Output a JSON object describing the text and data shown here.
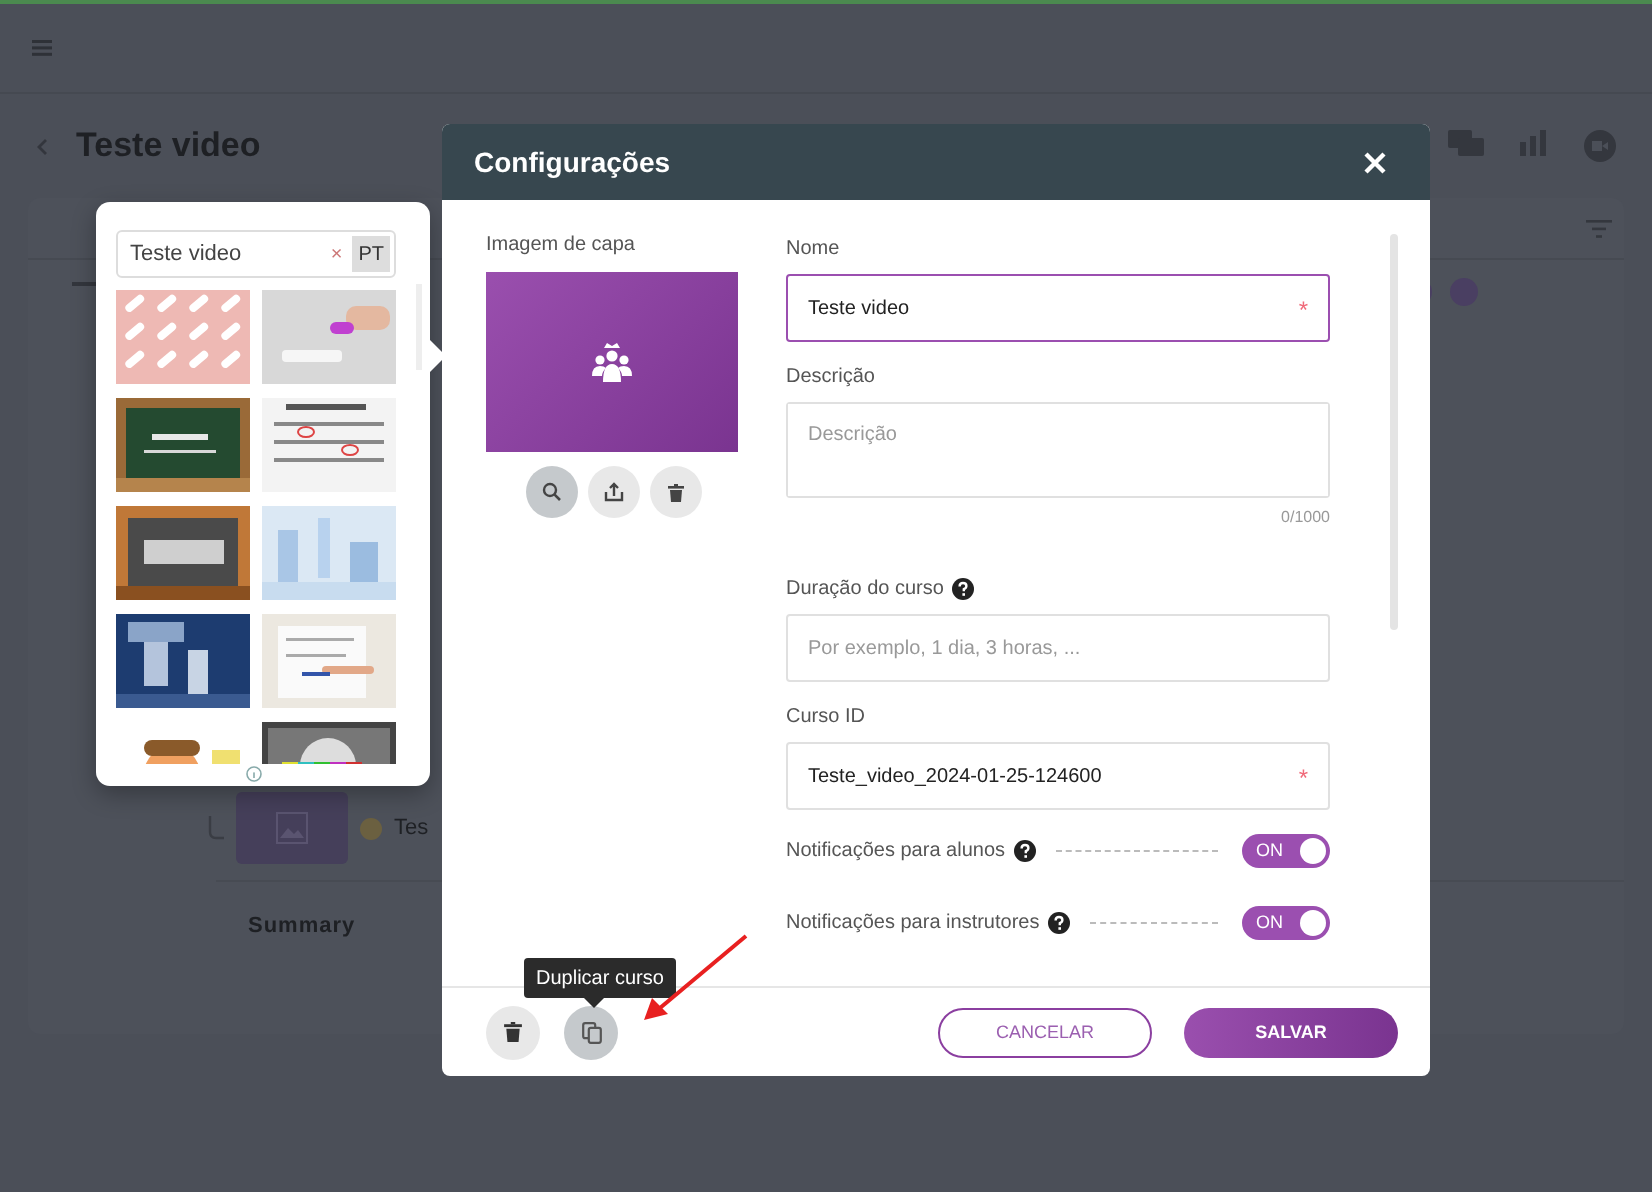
{
  "page": {
    "title": "Teste video",
    "lesson_title": "Tes",
    "section": "Summary"
  },
  "image_picker": {
    "search": {
      "value": "Teste video"
    },
    "clear": "×",
    "language": "PT"
  },
  "dialog": {
    "title": "Configurações",
    "cover": {
      "label": "Imagem de capa"
    },
    "fields": [
      {
        "kind": "input",
        "label": "Nome",
        "value": "Teste video",
        "required_mark": "*",
        "focused": true
      },
      {
        "kind": "textarea",
        "label": "Descrição",
        "placeholder": "Descrição",
        "counter": "0/1000"
      },
      {
        "kind": "input",
        "label": "Duração do curso",
        "help": true,
        "placeholder": "Por exemplo, 1 dia, 3 horas, ..."
      },
      {
        "kind": "input",
        "label": "Curso ID",
        "value": "Teste_video_2024-01-25-124600",
        "required_mark": "*"
      }
    ],
    "toggles": [
      {
        "label": "Notificações para alunos",
        "on": true,
        "state_label": "ON"
      },
      {
        "label": "Notificações para instrutores",
        "on": true,
        "state_label": "ON"
      }
    ],
    "cancel": "CANCELAR",
    "save": "SALVAR",
    "tooltip": "Duplicar curso"
  }
}
